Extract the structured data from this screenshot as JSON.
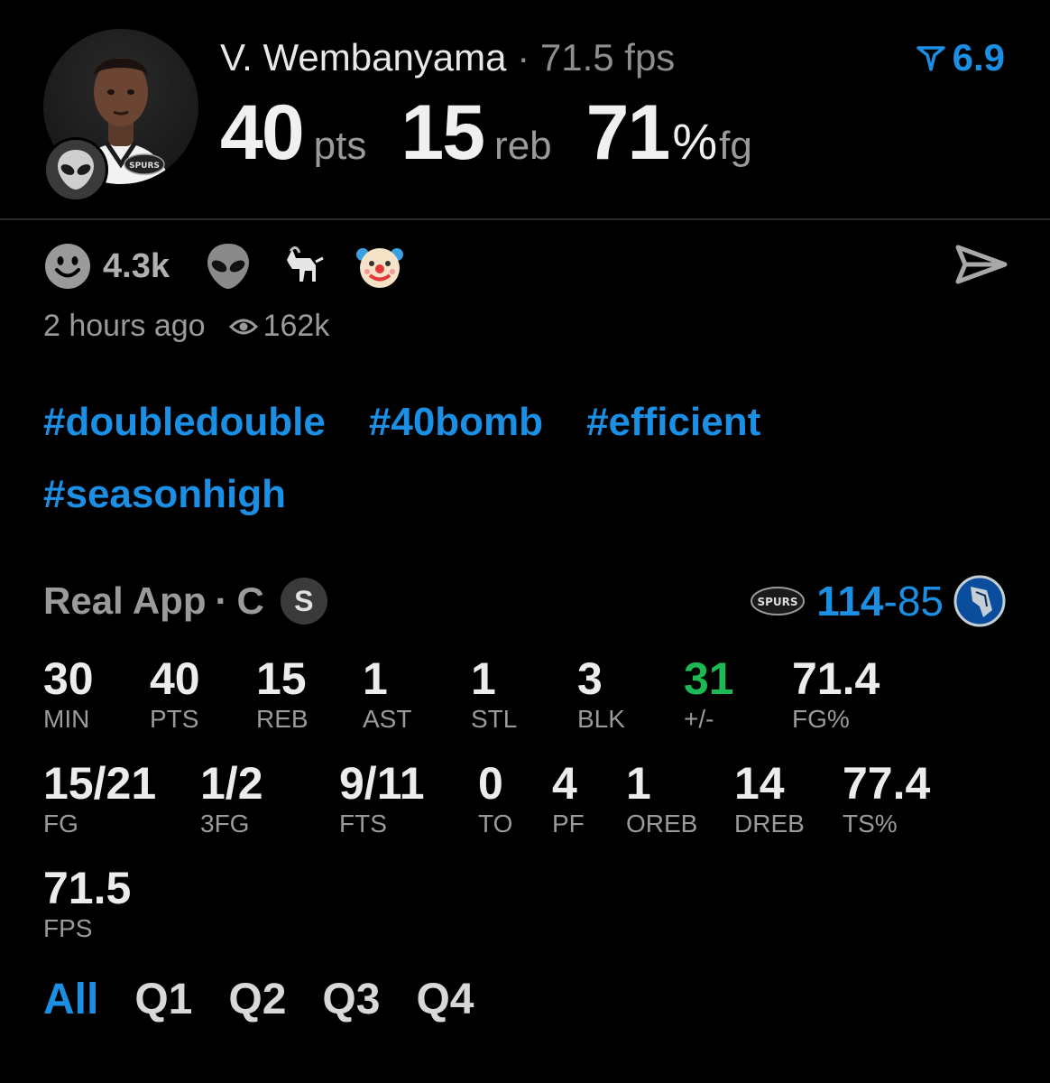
{
  "player": {
    "name": "V. Wembanyama",
    "separator": "·",
    "fps_text": "71.5 fps",
    "rank_value": "6.9",
    "big_stats": [
      {
        "value": "40",
        "unit": "pts"
      },
      {
        "value": "15",
        "unit": "reb"
      },
      {
        "value": "71",
        "pct": "%",
        "unit": "fg"
      }
    ],
    "team_badge": "SPURS"
  },
  "reactions": {
    "count": "4.3k",
    "icons": [
      "smiley-icon",
      "alien-icon",
      "goat-icon",
      "clown-icon"
    ]
  },
  "meta": {
    "time_ago": "2 hours ago",
    "views": "162k"
  },
  "hashtags": [
    "#doubledouble",
    "#40bomb",
    "#efficient",
    "#seasonhigh"
  ],
  "game": {
    "source": "Real App",
    "separator": "·",
    "position": "C",
    "badge": "S",
    "score_team": "114",
    "score_dash": "-",
    "score_opp": "85",
    "team_logo_text": "SPURS"
  },
  "stats_row1": [
    {
      "value": "30",
      "label": "MIN"
    },
    {
      "value": "40",
      "label": "PTS"
    },
    {
      "value": "15",
      "label": "REB"
    },
    {
      "value": "1",
      "label": "AST"
    },
    {
      "value": "1",
      "label": "STL"
    },
    {
      "value": "3",
      "label": "BLK"
    },
    {
      "value": "31",
      "label": "+/-"
    },
    {
      "value": "71.4",
      "label": "FG%"
    }
  ],
  "stats_row2": [
    {
      "value": "15/21",
      "label": "FG"
    },
    {
      "value": "1/2",
      "label": "3FG"
    },
    {
      "value": "9/11",
      "label": "FTS"
    },
    {
      "value": "0",
      "label": "TO"
    },
    {
      "value": "4",
      "label": "PF"
    },
    {
      "value": "1",
      "label": "OREB"
    },
    {
      "value": "14",
      "label": "DREB"
    },
    {
      "value": "77.4",
      "label": "TS%"
    }
  ],
  "stats_row3": [
    {
      "value": "71.5",
      "label": "FPS"
    }
  ],
  "tabs": [
    "All",
    "Q1",
    "Q2",
    "Q3",
    "Q4"
  ],
  "colors": {
    "accent": "#1a8fe3",
    "positive": "#1db954",
    "background": "#000000"
  }
}
